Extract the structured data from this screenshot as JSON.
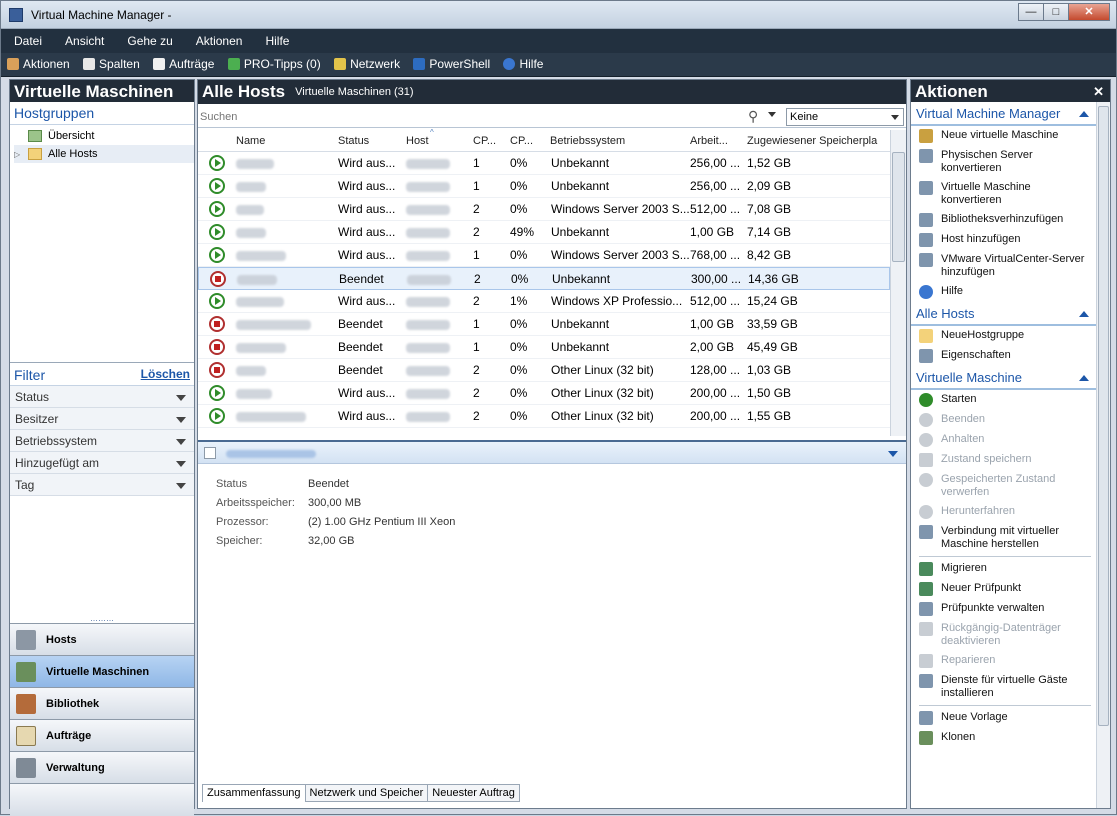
{
  "window": {
    "title": "Virtual Machine Manager -"
  },
  "menu": [
    "Datei",
    "Ansicht",
    "Gehe zu",
    "Aktionen",
    "Hilfe"
  ],
  "toolbar": [
    "Aktionen",
    "Spalten",
    "Aufträge",
    "PRO-Tipps (0)",
    "Netzwerk",
    "PowerShell",
    "Hilfe"
  ],
  "left": {
    "title": "Virtuelle Maschinen",
    "hostgroups_label": "Hostgruppen",
    "tree": [
      "Übersicht",
      "Alle Hosts"
    ],
    "filter_label": "Filter",
    "filter_clear": "Löschen",
    "filters": [
      "Status",
      "Besitzer",
      "Betriebssystem",
      "Hinzugefügt am",
      "Tag"
    ],
    "nav": [
      "Hosts",
      "Virtuelle Maschinen",
      "Bibliothek",
      "Aufträge",
      "Verwaltung"
    ]
  },
  "center": {
    "title": "Alle Hosts",
    "subtitle": "Virtuelle Maschinen (31)",
    "search_placeholder": "Suchen",
    "filter_value": "Keine",
    "columns": [
      "Name",
      "Status",
      "Host",
      "CP...",
      "CP...",
      "Betriebssystem",
      "Arbeit...",
      "Zugewiesener Speicherpla"
    ],
    "rows": [
      {
        "state": "run",
        "status": "Wird aus...",
        "cpus": "1",
        "cpu": "0%",
        "os": "Unbekannt",
        "mem": "256,00 ...",
        "storage": "1,52 GB"
      },
      {
        "state": "run",
        "status": "Wird aus...",
        "cpus": "1",
        "cpu": "0%",
        "os": "Unbekannt",
        "mem": "256,00 ...",
        "storage": "2,09 GB"
      },
      {
        "state": "run",
        "status": "Wird aus...",
        "cpus": "2",
        "cpu": "0%",
        "os": "Windows Server 2003 S...",
        "mem": "512,00 ...",
        "storage": "7,08 GB"
      },
      {
        "state": "run",
        "status": "Wird aus...",
        "cpus": "2",
        "cpu": "49%",
        "os": "Unbekannt",
        "mem": "1,00 GB",
        "storage": "7,14 GB"
      },
      {
        "state": "run",
        "status": "Wird aus...",
        "cpus": "1",
        "cpu": "0%",
        "os": "Windows Server 2003 S...",
        "mem": "768,00 ...",
        "storage": "8,42 GB"
      },
      {
        "state": "stop",
        "status": "Beendet",
        "cpus": "2",
        "cpu": "0%",
        "os": "Unbekannt",
        "mem": "300,00 ...",
        "storage": "14,36 GB",
        "selected": true
      },
      {
        "state": "run",
        "status": "Wird aus...",
        "cpus": "2",
        "cpu": "1%",
        "os": "Windows XP Professio...",
        "mem": "512,00 ...",
        "storage": "15,24 GB"
      },
      {
        "state": "stop",
        "status": "Beendet",
        "cpus": "1",
        "cpu": "0%",
        "os": "Unbekannt",
        "mem": "1,00 GB",
        "storage": "33,59 GB"
      },
      {
        "state": "stop",
        "status": "Beendet",
        "cpus": "1",
        "cpu": "0%",
        "os": "Unbekannt",
        "mem": "2,00 GB",
        "storage": "45,49 GB"
      },
      {
        "state": "stop",
        "status": "Beendet",
        "cpus": "2",
        "cpu": "0%",
        "os": "Other Linux (32 bit)",
        "mem": "128,00 ...",
        "storage": "1,03 GB"
      },
      {
        "state": "run",
        "status": "Wird aus...",
        "cpus": "2",
        "cpu": "0%",
        "os": "Other Linux (32 bit)",
        "mem": "200,00 ...",
        "storage": "1,50 GB"
      },
      {
        "state": "run",
        "status": "Wird aus...",
        "cpus": "2",
        "cpu": "0%",
        "os": "Other Linux (32 bit)",
        "mem": "200,00 ...",
        "storage": "1,55 GB"
      }
    ],
    "details": [
      {
        "k": "Status",
        "v": "Beendet"
      },
      {
        "k": "Arbeitsspeicher:",
        "v": "300,00 MB"
      },
      {
        "k": "Prozessor:",
        "v": "(2) 1.00 GHz Pentium III Xeon"
      },
      {
        "k": "Speicher:",
        "v": "32,00 GB"
      }
    ],
    "tabs": [
      "Zusammenfassung",
      "Netzwerk und Speicher",
      "Neuester Auftrag"
    ]
  },
  "right": {
    "title": "Aktionen",
    "sections": [
      {
        "label": "Virtual Machine Manager",
        "items": [
          {
            "label": "Neue virtuelle Maschine",
            "icon": "new-vm-icon"
          },
          {
            "label": "Physischen Server konvertieren",
            "icon": "p2v-icon"
          },
          {
            "label": "Virtuelle Maschine konvertieren",
            "icon": "v2v-icon"
          },
          {
            "label": "Bibliotheksverhinzufügen",
            "icon": "library-icon"
          },
          {
            "label": "Host hinzufügen",
            "icon": "host-icon"
          },
          {
            "label": "VMware VirtualCenter-Server hinzufügen",
            "icon": "vmware-icon"
          },
          {
            "label": "Hilfe",
            "icon": "help-icon"
          }
        ]
      },
      {
        "label": "Alle Hosts",
        "items": [
          {
            "label": "NeueHostgruppe",
            "icon": "folder-icon"
          },
          {
            "label": "Eigenschaften",
            "icon": "properties-icon"
          }
        ]
      },
      {
        "label": "Virtuelle Maschine",
        "items": [
          {
            "label": "Starten",
            "icon": "start-icon"
          },
          {
            "label": "Beenden",
            "icon": "stop-icon",
            "disabled": true
          },
          {
            "label": "Anhalten",
            "icon": "pause-icon",
            "disabled": true
          },
          {
            "label": "Zustand speichern",
            "icon": "save-icon",
            "disabled": true
          },
          {
            "label": "Gespeicherten Zustand verwerfen",
            "icon": "discard-icon",
            "disabled": true
          },
          {
            "label": "Herunterfahren",
            "icon": "shutdown-icon",
            "disabled": true
          },
          {
            "label": "Verbindung mit virtueller Maschine herstellen",
            "icon": "connect-icon",
            "sep_after": true
          },
          {
            "label": "Migrieren",
            "icon": "migrate-icon"
          },
          {
            "label": "Neuer Prüfpunkt",
            "icon": "checkpoint-icon"
          },
          {
            "label": "Prüfpunkte verwalten",
            "icon": "manage-checkpoints-icon"
          },
          {
            "label": "Rückgängig-Datenträger deaktivieren",
            "icon": "undo-disk-icon",
            "disabled": true
          },
          {
            "label": "Reparieren",
            "icon": "repair-icon",
            "disabled": true
          },
          {
            "label": "Dienste für virtuelle Gäste installieren",
            "icon": "guest-services-icon",
            "sep_after": true
          },
          {
            "label": "Neue Vorlage",
            "icon": "template-icon"
          },
          {
            "label": "Klonen",
            "icon": "clone-icon"
          }
        ]
      }
    ]
  }
}
